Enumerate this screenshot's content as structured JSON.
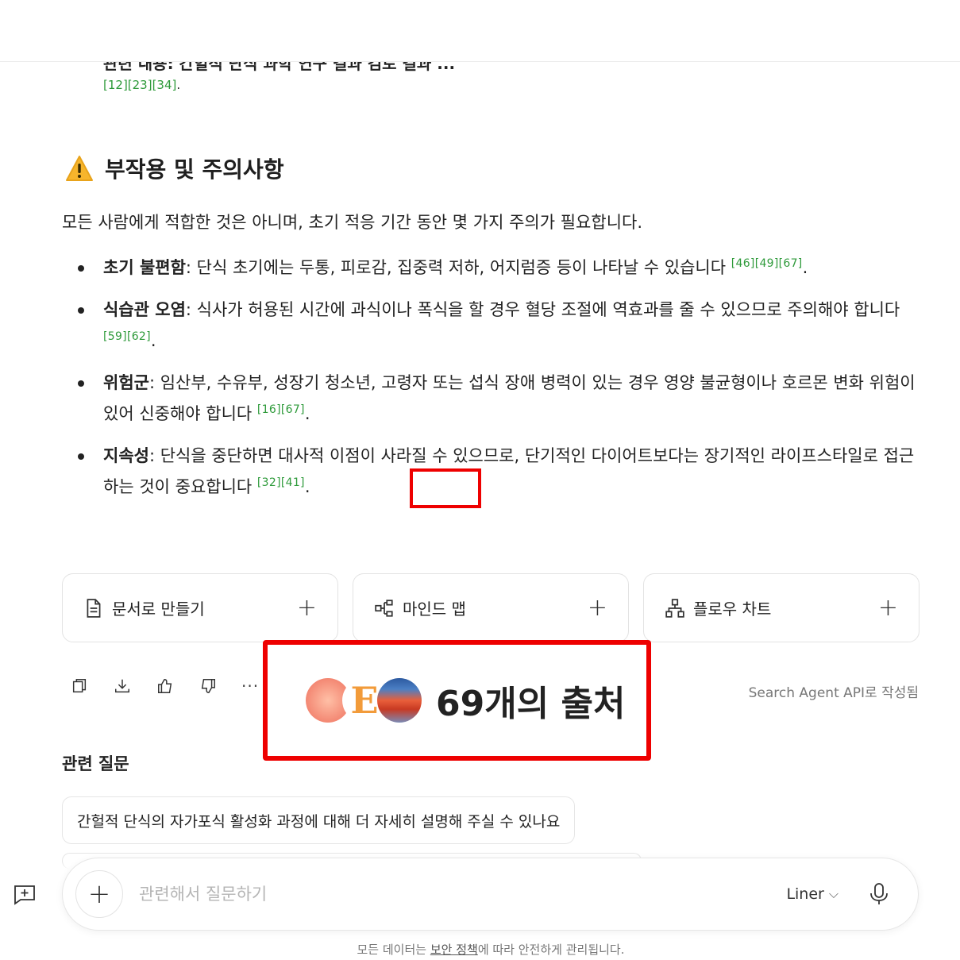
{
  "top": {
    "cut_off_line": "관련 내용: 간헐적 단식 과학 연구 결과 검토 결과 ...",
    "citations": "[12][23][34]"
  },
  "section": {
    "icon": "warning-icon",
    "title": "부작용 및 주의사항",
    "intro": "모든 사람에게 적합한 것은 아니며, 초기 적응 기간 동안 몇 가지 주의가 필요합니다."
  },
  "bullets": [
    {
      "term": "초기 불편함",
      "text": ": 단식 초기에는 두통, 피로감, 집중력 저하, 어지럼증 등이 나타날 수 있습니다",
      "cite": "[46][49][67]"
    },
    {
      "term": "식습관 오염",
      "text": ": 식사가 허용된 시간에 과식이나 폭식을 할 경우 혈당 조절에 역효과를 줄 수 있으므로 주의해야 합니다",
      "cite": "[59][62]"
    },
    {
      "term": "위험군",
      "text": ": 임산부, 수유부, 성장기 청소년, 고령자 또는 섭식 장애 병력이 있는 경우 영양 불균형이나 호르몬 변화 위험이 있어 신중해야 합니다",
      "cite": "[16][67]"
    },
    {
      "term": "지속성",
      "text": ": 단식을 중단하면 대사적 이점이 사라질 수 있으므로, 단기적인 다이어트보다는 장기적인 라이프스타일로 접근하는 것이 중요합니다",
      "cite": "[32][41]"
    }
  ],
  "actions": [
    {
      "icon": "document-icon",
      "label": "문서로 만들기"
    },
    {
      "icon": "mindmap-icon",
      "label": "마인드 맵"
    },
    {
      "icon": "flowchart-icon",
      "label": "플로우 차트"
    }
  ],
  "plus_glyph": "+",
  "toolbar": {
    "icons": [
      "copy-icon",
      "download-icon",
      "thumbs-up-icon",
      "thumbs-down-icon"
    ],
    "more": "···"
  },
  "sources": {
    "logo_letter": "E",
    "count_label": "69개의 출처"
  },
  "by_api": "Search Agent API로 작성됨",
  "related": {
    "title": "관련 질문",
    "questions": [
      "간헐적 단식의 자가포식 활성화 과정에 대해 더 자세히 설명해 주실 수 있나요"
    ]
  },
  "ask": {
    "placeholder": "관련해서 질문하기",
    "model": "Liner",
    "model_chevron": "⌵"
  },
  "footer": {
    "pre": "모든 데이터는 ",
    "link": "보안 정책",
    "post": "에 따라 안전하게 관리됩니다."
  }
}
